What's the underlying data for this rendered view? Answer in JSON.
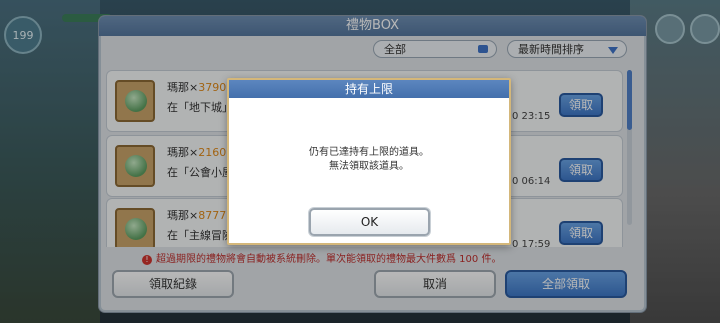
{
  "hud": {
    "level": "199"
  },
  "panel": {
    "title": "禮物BOX",
    "filter_select": "全部",
    "sort_select": "最新時間排序"
  },
  "items": [
    {
      "name": "瑪那×",
      "qty": "3790",
      "source": "在「地下城」",
      "time": "0 23:15",
      "claim_label": "領取"
    },
    {
      "name": "瑪那×",
      "qty": "2160",
      "source": "在「公會小屋",
      "time": "0 06:14",
      "claim_label": "領取"
    },
    {
      "name": "瑪那×",
      "qty": "8777",
      "source": "在「主線冒險",
      "time": "0 17:59",
      "claim_label": "領取"
    }
  ],
  "notice": "超過期限的禮物將會自動被系統刪除。單次能領取的禮物最大件數爲 100 件。",
  "buttons": {
    "history": "領取紀錄",
    "cancel": "取消",
    "claim_all": "全部領取"
  },
  "modal": {
    "title": "持有上限",
    "line1": "仍有已達持有上限的道具。",
    "line2": "無法領取該道具。",
    "ok_label": "OK"
  },
  "colors": {
    "header_blue": "#5c86bf",
    "button_blue": "#3f78c7",
    "qty_orange": "#e08a1a",
    "notice_red": "#c0302e"
  }
}
